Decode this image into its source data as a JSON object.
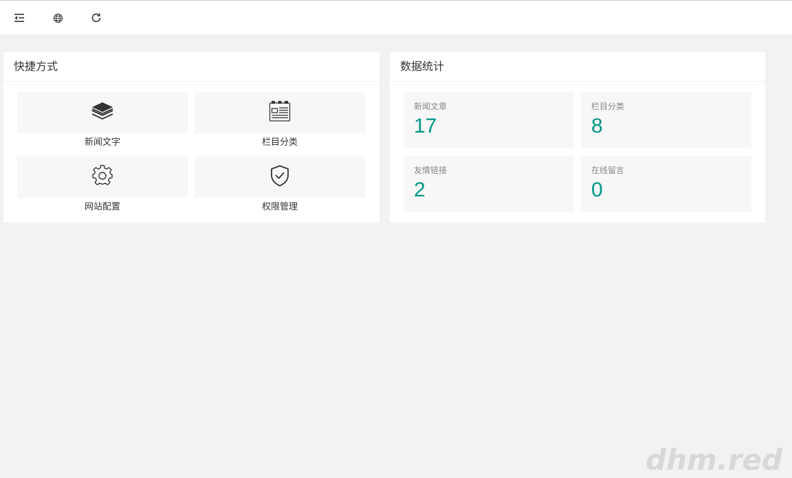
{
  "topbar": {
    "icons": [
      "menu-fold-icon",
      "globe-icon",
      "refresh-icon"
    ]
  },
  "shortcuts": {
    "title": "快捷方式",
    "items": [
      {
        "label": "新闻文字",
        "icon": "layers-icon"
      },
      {
        "label": "栏目分类",
        "icon": "newspaper-icon"
      },
      {
        "label": "网站配置",
        "icon": "gear-icon"
      },
      {
        "label": "权限管理",
        "icon": "shield-check-icon"
      }
    ]
  },
  "stats": {
    "title": "数据统计",
    "items": [
      {
        "label": "新闻文章",
        "value": "17"
      },
      {
        "label": "栏目分类",
        "value": "8"
      },
      {
        "label": "友情链接",
        "value": "2"
      },
      {
        "label": "在线留言",
        "value": "0"
      }
    ]
  },
  "watermark": "dhm.red",
  "colors": {
    "accent": "#009688",
    "background": "#f2f2f2",
    "tile": "#f7f7f7"
  }
}
